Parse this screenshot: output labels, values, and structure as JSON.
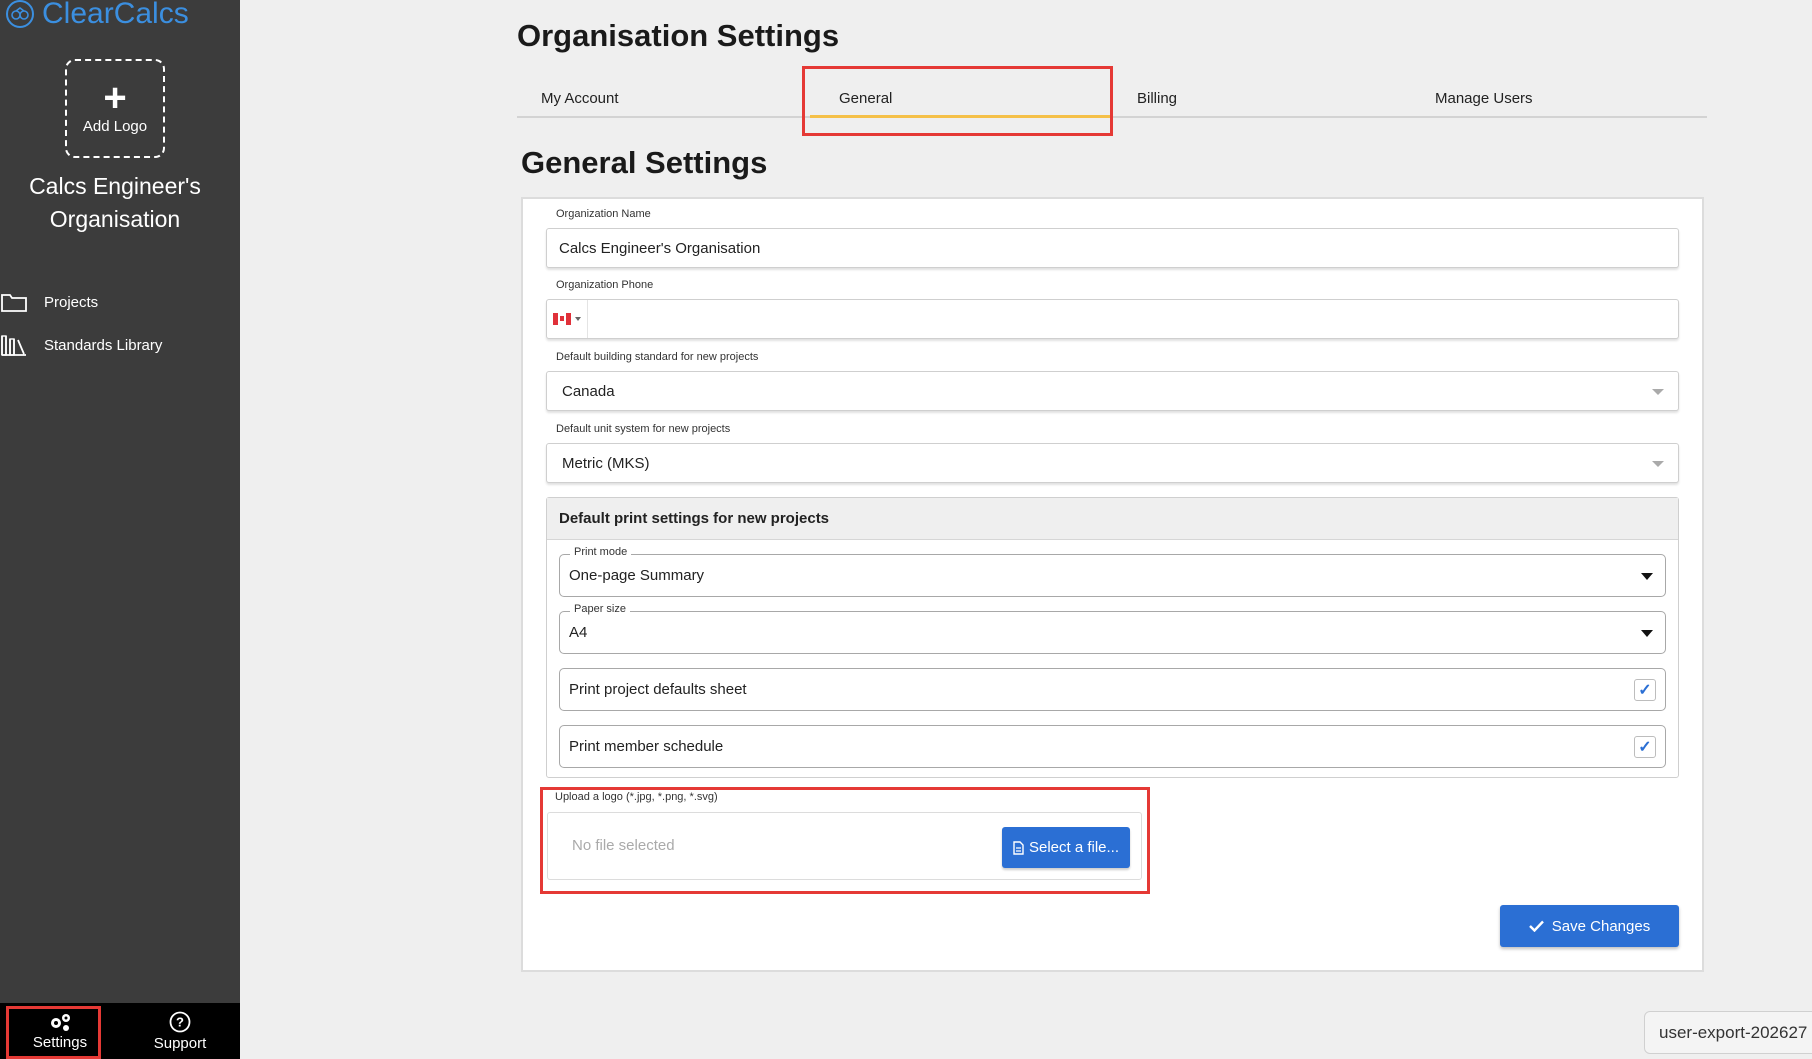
{
  "brand": {
    "name": "ClearCalcs",
    "icon": "clearcalcs-logo-icon"
  },
  "sidebar": {
    "add_logo_label": "Add Logo",
    "org_name_line1": "Calcs Engineer's",
    "org_name_line2": "Organisation",
    "items": [
      {
        "label": "Projects",
        "icon": "folder-icon"
      },
      {
        "label": "Standards Library",
        "icon": "books-icon"
      }
    ],
    "bottom": [
      {
        "label": "Settings",
        "icon": "gears-icon"
      },
      {
        "label": "Support",
        "icon": "help-circle-icon"
      }
    ]
  },
  "page": {
    "title": "Organisation Settings",
    "section_title": "General Settings"
  },
  "tabs": [
    {
      "label": "My Account"
    },
    {
      "label": "General",
      "active": true
    },
    {
      "label": "Billing"
    },
    {
      "label": "Manage Users"
    }
  ],
  "form": {
    "org_name_label": "Organization Name",
    "org_name_value": "Calcs Engineer's Organisation",
    "org_phone_label": "Organization Phone",
    "org_phone_value": "",
    "standard_label": "Default building standard for new projects",
    "standard_value": "Canada",
    "unit_label": "Default unit system for new projects",
    "unit_value": "Metric (MKS)",
    "print": {
      "heading": "Default print settings for new projects",
      "mode_label": "Print mode",
      "mode_value": "One-page Summary",
      "paper_label": "Paper size",
      "paper_value": "A4",
      "defaults_sheet_label": "Print project defaults sheet",
      "defaults_sheet_checked": true,
      "member_schedule_label": "Print member schedule",
      "member_schedule_checked": true
    },
    "upload_label": "Upload a logo (*.jpg, *.png, *.svg)",
    "upload_placeholder": "No file selected",
    "select_file_label": "Select a file...",
    "save_label": "Save Changes"
  },
  "export_chip": "user-export-202627",
  "colors": {
    "accent": "#2b6fd4",
    "sidebar": "#3c3c3c",
    "tab_active": "#f5c048",
    "highlight": "#e53935"
  }
}
